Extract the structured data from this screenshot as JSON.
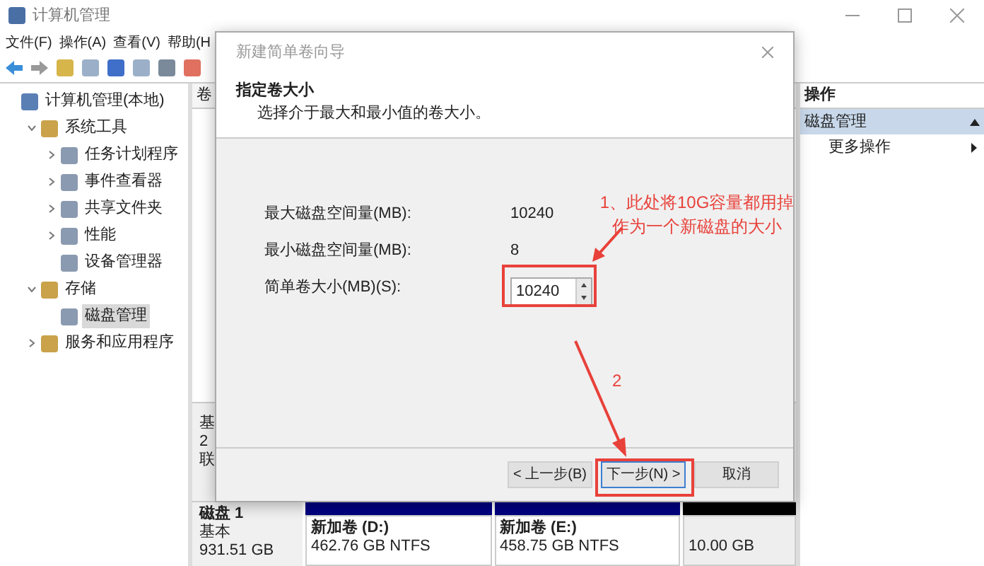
{
  "window": {
    "title": "计算机管理"
  },
  "menu": [
    "文件(F)",
    "操作(A)",
    "查看(V)",
    "帮助(H"
  ],
  "tree": [
    {
      "label": "计算机管理(本地)",
      "selected": false,
      "children": [
        {
          "label": "系统工具",
          "selected": false,
          "expanded": true,
          "children": [
            {
              "label": "任务计划程序",
              "selected": false,
              "expanded": false
            },
            {
              "label": "事件查看器",
              "selected": false,
              "expanded": false
            },
            {
              "label": "共享文件夹",
              "selected": false,
              "expanded": false
            },
            {
              "label": "性能",
              "selected": false,
              "expanded": false
            },
            {
              "label": "设备管理器",
              "selected": false
            }
          ]
        },
        {
          "label": "存储",
          "selected": false,
          "expanded": true,
          "children": [
            {
              "label": "磁盘管理",
              "selected": true
            }
          ]
        },
        {
          "label": "服务和应用程序",
          "selected": false,
          "expanded": false
        }
      ]
    }
  ],
  "volume_list": {
    "column_1": "卷"
  },
  "disks": [
    {
      "lines": [
        "基",
        "2",
        "联"
      ]
    },
    {
      "name": "磁盘 1",
      "lines": [
        "基本",
        "931.51 GB"
      ],
      "partitions": [
        {
          "name": "新加卷 (D:)",
          "detail": "462.76 GB NTFS",
          "kind": "primary"
        },
        {
          "name": "新加卷 (E:)",
          "detail": "458.75 GB NTFS",
          "kind": "primary"
        },
        {
          "detail": "10.00 GB",
          "kind": "unallocated"
        }
      ]
    }
  ],
  "actions": {
    "header": "操作",
    "items": [
      {
        "label": "磁盘管理",
        "kind": "section"
      },
      {
        "label": "更多操作",
        "kind": "submenu"
      }
    ]
  },
  "dialog": {
    "title": "新建简单卷向导",
    "heading": "指定卷大小",
    "subtitle": "选择介于最大和最小值的卷大小。",
    "fields": [
      {
        "label": "最大磁盘空间量(MB):",
        "value": "10240",
        "kind": "readout"
      },
      {
        "label": "最小磁盘空间量(MB):",
        "value": "8",
        "kind": "readout"
      },
      {
        "label": "简单卷大小(MB)(S):",
        "value": "10240",
        "kind": "spinner"
      }
    ],
    "buttons": [
      {
        "label": "< 上一步(B)",
        "kind": "normal"
      },
      {
        "label": "下一步(N) >",
        "kind": "default"
      },
      {
        "label": "取消",
        "kind": "normal"
      }
    ]
  },
  "annotations": [
    {
      "text": "1、此处将10G容量都用掉作为一个新磁盘的大小"
    },
    {
      "text": "2"
    }
  ]
}
